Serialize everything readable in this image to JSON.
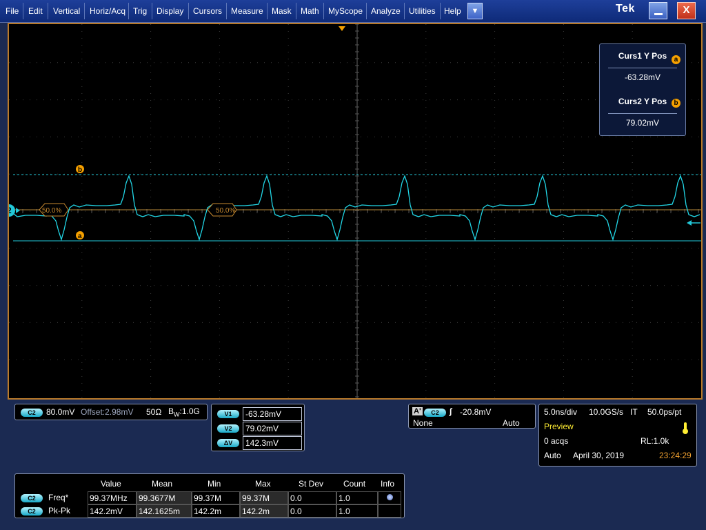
{
  "menu": {
    "items": [
      "File",
      "Edit",
      "Vertical",
      "Horiz/Acq",
      "Trig",
      "Display",
      "Cursors",
      "Measure",
      "Mask",
      "Math",
      "MyScope",
      "Analyze",
      "Utilities",
      "Help"
    ],
    "dropdown_glyph": "▼",
    "logo": "Tek",
    "close_glyph": "X"
  },
  "scope": {
    "channel_marker": "2",
    "ref_label_1": "50.0%",
    "ref_label_2": "50.0%",
    "cursor_a_label": "a",
    "cursor_b_label": "b",
    "colors": {
      "trace": "#22d8e8",
      "cursor": "#22c8d8",
      "grid": "#555555",
      "frame": "#b97a2a",
      "marker": "#f5a000"
    }
  },
  "cursor_readout": {
    "curs1_title": "Curs1 Y Pos",
    "curs1_badge": "a",
    "curs1_value": "-63.28mV",
    "curs2_title": "Curs2 Y Pos",
    "curs2_badge": "b",
    "curs2_value": "79.02mV"
  },
  "channel_panel": {
    "badge": "C2",
    "scale": "80.0mV",
    "offset": "Offset:2.98mV",
    "impedance": "50Ω",
    "bw_prefix": "B",
    "bw_sub": "W",
    "bw_value": ":1.0G"
  },
  "cursor_panel": {
    "v1_badge": "V1",
    "v1_value": "-63.28mV",
    "v2_badge": "V2",
    "v2_value": "79.02mV",
    "dv_badge": "ΔV",
    "dv_value": "142.3mV"
  },
  "trigger_panel": {
    "a_label": "A'",
    "badge": "C2",
    "slope_glyph": "∫",
    "level": "-20.8mV",
    "coupling": "None",
    "mode": "Auto"
  },
  "horizontal_panel": {
    "timebase": "5.0ns/div",
    "sample_rate": "10.0GS/s",
    "mode": "IT",
    "resolution": "50.0ps/pt",
    "state": "Preview",
    "acqs": "0 acqs",
    "record_length": "RL:1.0k",
    "trigger_mode": "Auto",
    "date": "April 30, 2019",
    "time": "23:24:29"
  },
  "measurements": {
    "headers": [
      "Value",
      "Mean",
      "Min",
      "Max",
      "St Dev",
      "Count",
      "Info"
    ],
    "rows": [
      {
        "badge": "C2",
        "name": "Freq*",
        "value": "99.37MHz",
        "mean": "99.3677M",
        "min": "99.37M",
        "max": "99.37M",
        "stdev": "0.0",
        "count": "1.0"
      },
      {
        "badge": "C2",
        "name": "Pk-Pk",
        "value": "142.2mV",
        "mean": "142.1625m",
        "min": "142.2m",
        "max": "142.2m",
        "stdev": "0.0",
        "count": "1.0"
      }
    ]
  }
}
